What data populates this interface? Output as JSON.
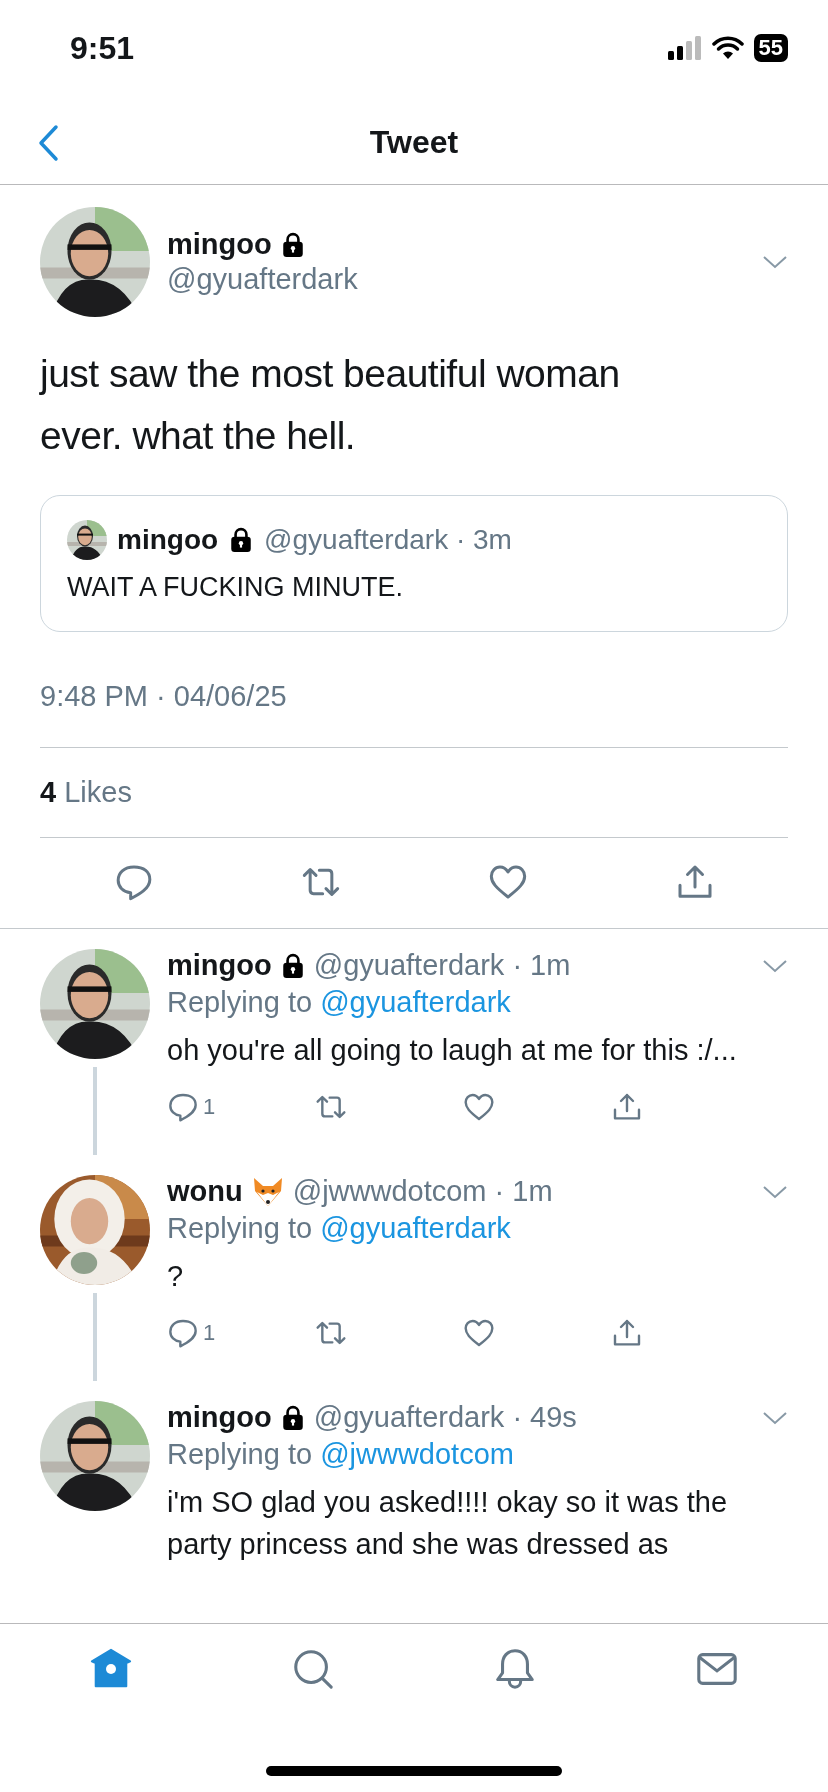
{
  "status_bar": {
    "time": "9:51",
    "battery": "55"
  },
  "header": {
    "title": "Tweet"
  },
  "tweet": {
    "name": "mingoo",
    "badge": {
      "kind": "lock"
    },
    "handle": "@gyuafterdark",
    "text": "just saw the most beautiful woman ever. what the hell.",
    "quote": {
      "name": "mingoo",
      "badge": {
        "kind": "lock"
      },
      "meta": "@gyuafterdark · 3m",
      "text": "WAIT A FUCKING MINUTE."
    },
    "timestamp": "9:48 PM · 04/06/25",
    "likes_count": "4",
    "likes_label": "Likes"
  },
  "replies": [
    {
      "name": "mingoo",
      "badge": {
        "kind": "lock"
      },
      "meta": "@gyuafterdark · 1m",
      "replying_label": "Replying to",
      "replying_to": "@gyuafterdark",
      "text": "oh you're all going to laugh at me for this :/...",
      "reply_count": "1",
      "thread_line": true
    },
    {
      "name": "wonu",
      "badge": {
        "kind": "fox"
      },
      "meta": "@jwwwdotcom · 1m",
      "replying_label": "Replying to",
      "replying_to": "@gyuafterdark",
      "text": "?",
      "reply_count": "1",
      "thread_line": true
    },
    {
      "name": "mingoo",
      "badge": {
        "kind": "lock"
      },
      "meta": "@gyuafterdark · 49s",
      "replying_label": "Replying to",
      "replying_to": "@jwwwdotcom",
      "text": "i'm SO glad you asked!!!! okay so it was the party princess and she was dressed as",
      "thread_line": false
    }
  ],
  "tab_bar": [
    {
      "kind": "home",
      "selected": true
    },
    {
      "kind": "search",
      "selected": false
    },
    {
      "kind": "bell",
      "selected": false
    },
    {
      "kind": "mail",
      "selected": false
    }
  ]
}
